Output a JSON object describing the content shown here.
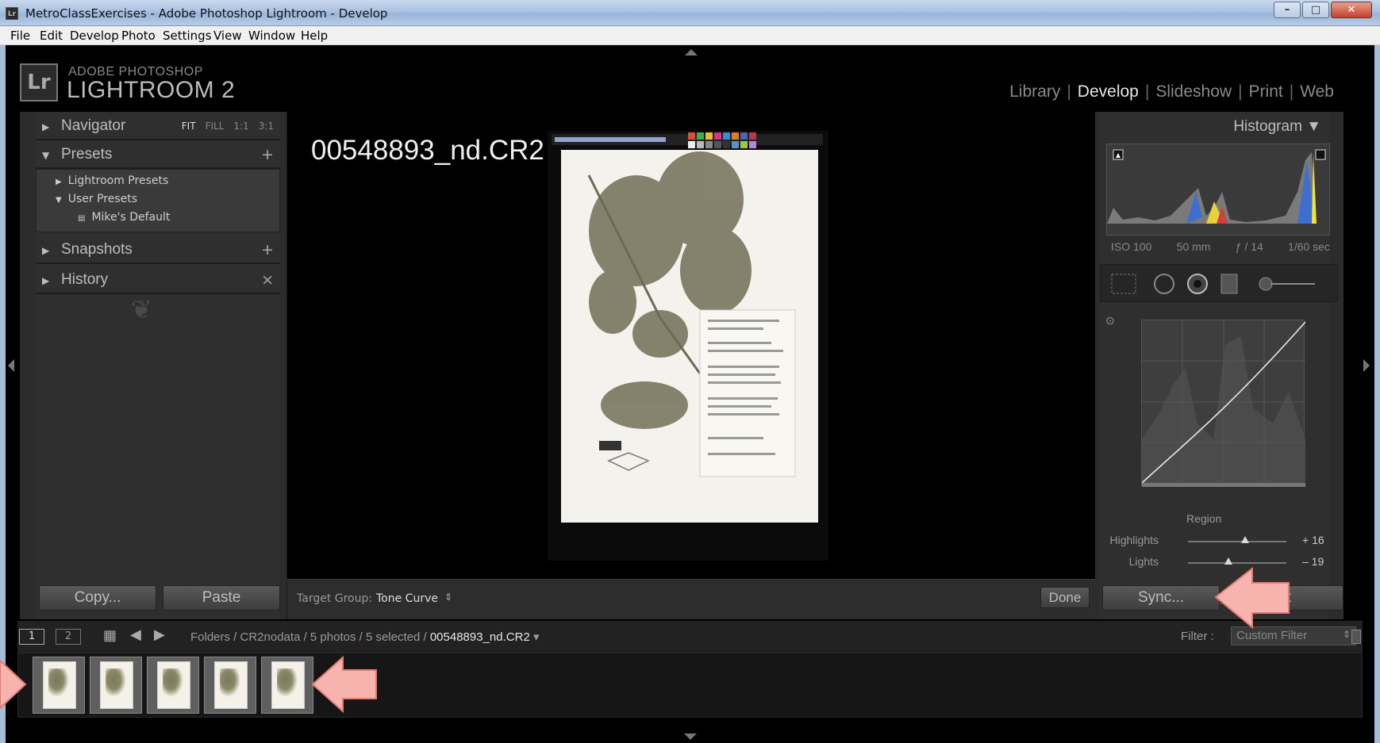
{
  "window": {
    "app_icon": "Lr",
    "title": "MetroClassExercises - Adobe Photoshop Lightroom - Develop",
    "minimize": "–",
    "maximize": "□",
    "close": "✕"
  },
  "menu": [
    "File",
    "Edit",
    "Develop",
    "Photo",
    "Settings",
    "View",
    "Window",
    "Help"
  ],
  "brand": {
    "logo": "Lr",
    "line1": "ADOBE PHOTOSHOP",
    "line2": "LIGHTROOM 2"
  },
  "modules": [
    {
      "label": "Library",
      "active": false
    },
    {
      "label": "Develop",
      "active": true
    },
    {
      "label": "Slideshow",
      "active": false
    },
    {
      "label": "Print",
      "active": false
    },
    {
      "label": "Web",
      "active": false
    }
  ],
  "left_panel": {
    "navigator": {
      "label": "Navigator",
      "options": [
        "FIT",
        "FILL",
        "1:1",
        "3:1"
      ]
    },
    "presets": {
      "label": "Presets",
      "add": "+",
      "items": [
        {
          "label": "Lightroom Presets",
          "expanded": false
        },
        {
          "label": "User Presets",
          "expanded": true
        },
        {
          "label": "Mike's Default"
        }
      ]
    },
    "snapshots": {
      "label": "Snapshots",
      "add": "+"
    },
    "history": {
      "label": "History",
      "clear": "×"
    },
    "copy_button": "Copy...",
    "paste_button": "Paste"
  },
  "center": {
    "filename": "00548893_nd.CR2",
    "target_group_label": "Target Group:",
    "target_group_value": "Tone Curve",
    "done_button": "Done"
  },
  "right_panel": {
    "histogram_label": "Histogram",
    "exif": [
      "ISO 100",
      "50 mm",
      "ƒ / 14",
      "1/60 sec"
    ],
    "region_label": "Region",
    "sliders": [
      {
        "label": "Highlights",
        "value": "+ 16",
        "position": 0.58
      },
      {
        "label": "Lights",
        "value": "– 19",
        "position": 0.41
      }
    ],
    "sync_button": "Sync...",
    "reset_button": "et"
  },
  "filmstrip": {
    "page1": "1",
    "page2": "2",
    "path_prefix": "Folders / CR2nodata / 5 photos / 5 selected / ",
    "path_current": "00548893_nd.CR2",
    "filter_label": "Filter :",
    "filter_value": "Custom Filter",
    "thumbnail_count": 5
  },
  "colors": {
    "callout": "#f7b3ae",
    "panel_bg": "#2f2f2f",
    "module_active": "#e8e8e8"
  }
}
